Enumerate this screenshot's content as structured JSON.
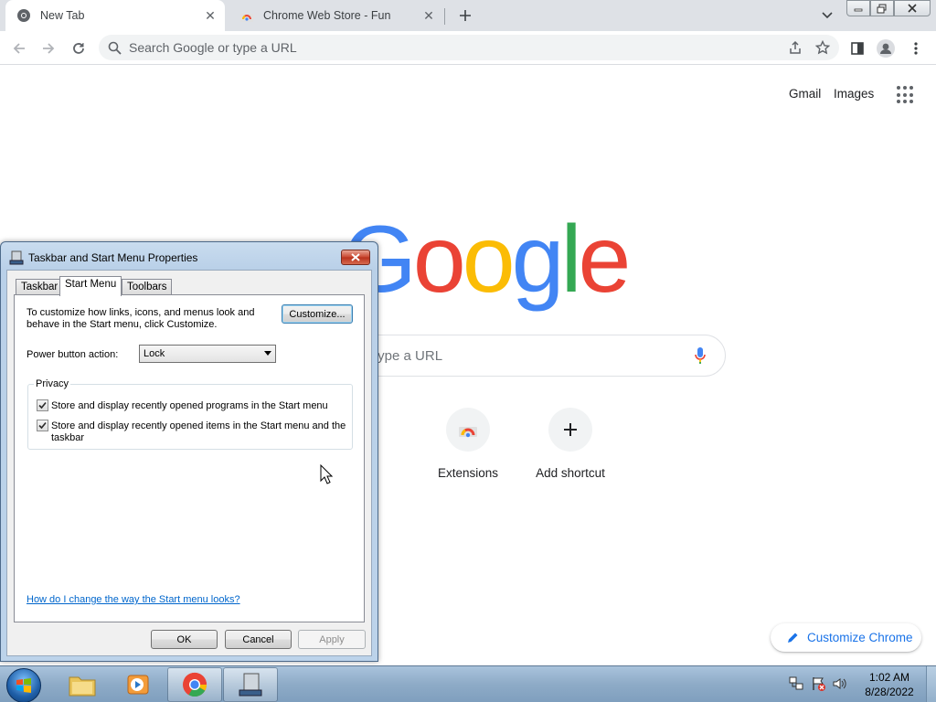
{
  "browser": {
    "tabs": [
      {
        "title": "New Tab",
        "active": true
      },
      {
        "title": "Chrome Web Store - Fun",
        "active": false
      }
    ],
    "omnibox_placeholder": "Search Google or type a URL"
  },
  "ntp": {
    "top_links": [
      "Gmail",
      "Images"
    ],
    "logo_letters": [
      "G",
      "o",
      "o",
      "g",
      "l",
      "e"
    ],
    "logo_colors": [
      "#4285f4",
      "#ea4335",
      "#fbbc05",
      "#4285f4",
      "#34a853",
      "#ea4335"
    ],
    "search_placeholder_visible": "type a URL",
    "shortcuts": [
      {
        "label": "Extensions",
        "icon": "chrome-web-store-icon"
      },
      {
        "label": "Add shortcut",
        "icon": "plus-icon"
      }
    ],
    "customize_label": "Customize Chrome"
  },
  "dialog": {
    "title": "Taskbar and Start Menu Properties",
    "tabs": [
      "Taskbar",
      "Start Menu",
      "Toolbars"
    ],
    "selected_tab": "Start Menu",
    "intro": "To customize how links, icons, and menus look and behave in the Start menu, click Customize.",
    "customize_button": "Customize...",
    "power_label": "Power button action:",
    "power_value": "Lock",
    "privacy_title": "Privacy",
    "privacy_items": [
      {
        "label": "Store and display recently opened programs in the Start menu",
        "checked": true
      },
      {
        "label": "Store and display recently opened items in the Start menu and the taskbar",
        "checked": true
      }
    ],
    "help_link": "How do I change the way the Start menu looks?",
    "buttons": {
      "ok": "OK",
      "cancel": "Cancel",
      "apply": "Apply"
    }
  },
  "taskbar": {
    "time": "1:02 AM",
    "date": "8/28/2022",
    "pinned": [
      "windows-explorer-icon",
      "media-player-icon",
      "chrome-icon",
      "taskbar-properties-icon"
    ]
  }
}
